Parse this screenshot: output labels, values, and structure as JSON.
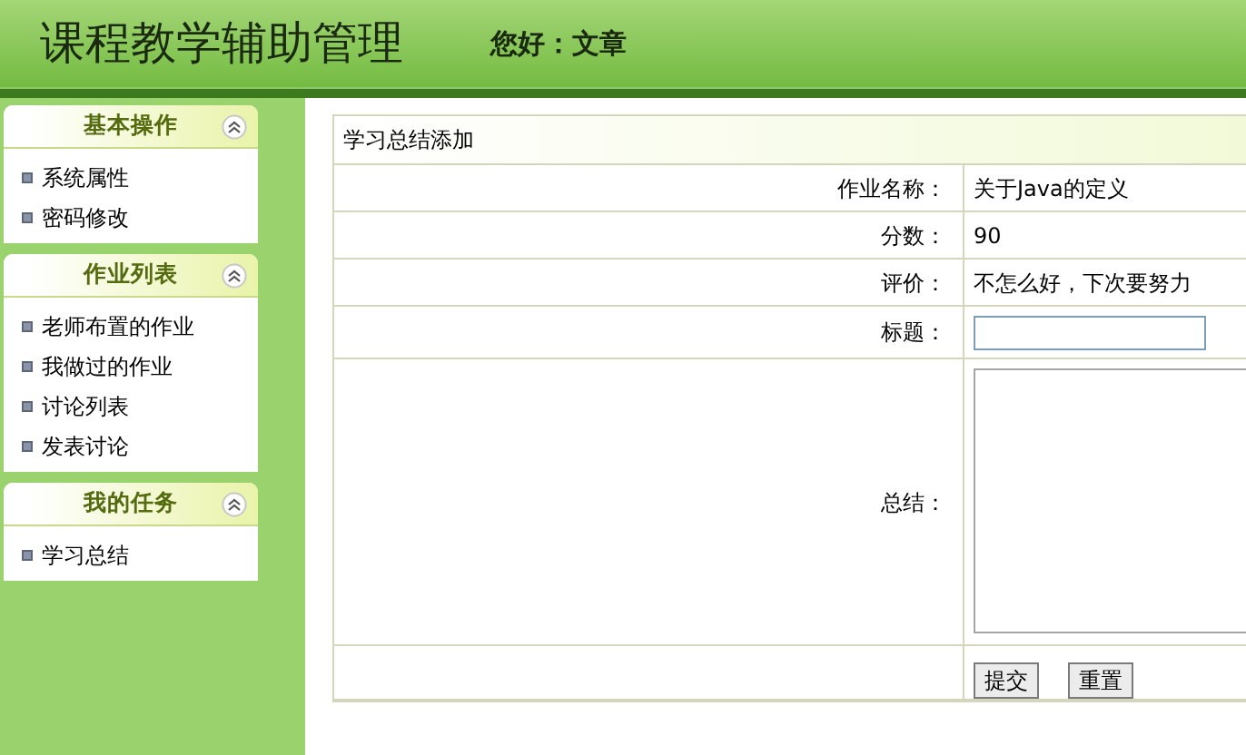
{
  "header": {
    "title": "课程教学辅助管理",
    "greeting": "您好：文章"
  },
  "sidebar": {
    "groups": [
      {
        "title": "基本操作",
        "expanded": true,
        "items": [
          "系统属性",
          "密码修改"
        ]
      },
      {
        "title": "作业列表",
        "expanded": true,
        "items": [
          "老师布置的作业",
          "我做过的作业",
          "讨论列表",
          "发表讨论"
        ]
      },
      {
        "title": "我的任务",
        "expanded": true,
        "items": [
          "学习总结"
        ]
      }
    ]
  },
  "form": {
    "title": "学习总结添加",
    "rows": [
      {
        "kind": "text",
        "label": "作业名称：",
        "value": "关于Java的定义"
      },
      {
        "kind": "text",
        "label": "分数：",
        "value": "90"
      },
      {
        "kind": "text",
        "label": "评价：",
        "value": "不怎么好，下次要努力"
      },
      {
        "kind": "input",
        "label": "标题："
      },
      {
        "kind": "textarea",
        "label": "总结："
      }
    ],
    "buttons": [
      "提交",
      "重置"
    ]
  }
}
